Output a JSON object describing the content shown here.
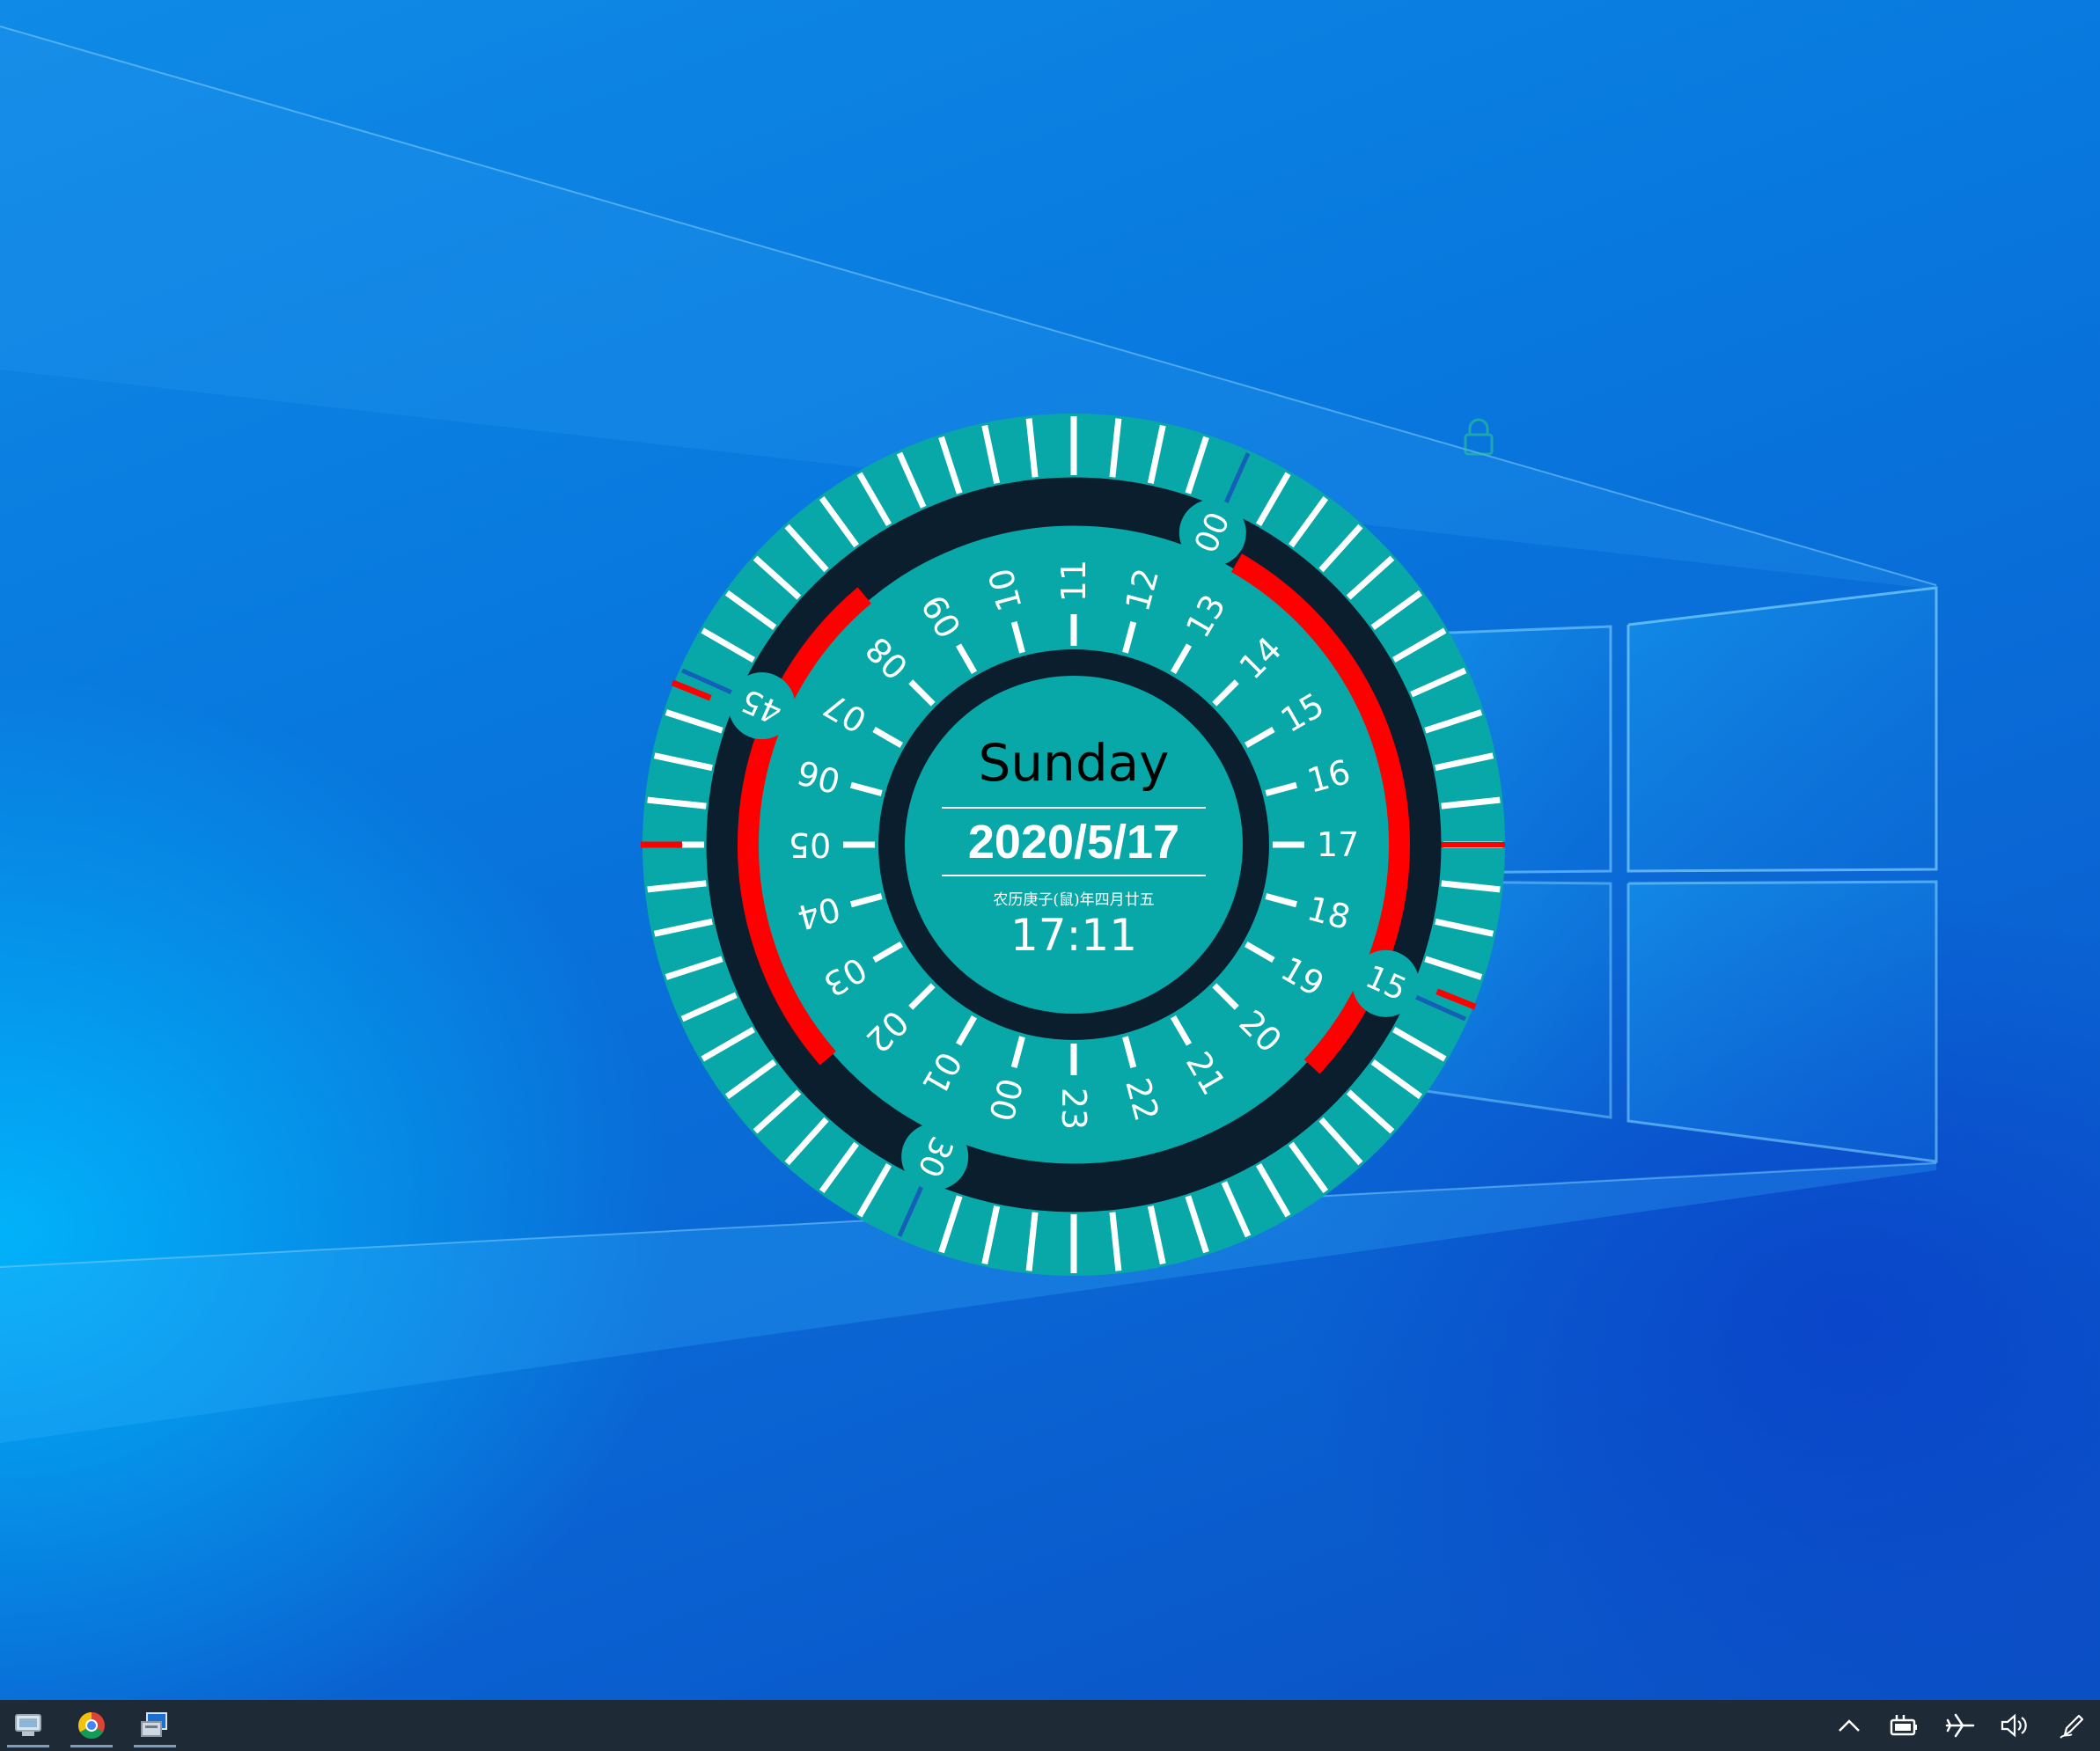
{
  "clock": {
    "weekday": "Sunday",
    "date": "2020/5/17",
    "lunar_date": "农历庚子(鼠)年四月廿五",
    "time": "17:11",
    "hour_labels": [
      "00",
      "01",
      "02",
      "03",
      "04",
      "05",
      "06",
      "07",
      "08",
      "09",
      "10",
      "11",
      "12",
      "13",
      "14",
      "15",
      "16",
      "17",
      "18",
      "19",
      "20",
      "21",
      "22",
      "23"
    ],
    "quarter_labels": [
      "00",
      "15",
      "30",
      "45"
    ],
    "current_hour": 17,
    "current_minute": 11,
    "colors": {
      "teal": "#08a8a8",
      "dark_ring": "#0b1e2e",
      "indicator_red": "#ff0000",
      "tick_white": "#ffffff",
      "accent_blue": "#1460b8"
    }
  },
  "taskbar": {
    "apps": [
      {
        "name": "desktop-manager",
        "icon": "computer-icon",
        "active": true
      },
      {
        "name": "chrome",
        "icon": "chrome-icon",
        "active": true
      },
      {
        "name": "settings-app",
        "icon": "app-window-icon",
        "active": true
      }
    ],
    "tray": [
      "chevron-up-icon",
      "battery-plug-icon",
      "airplane-mode-icon",
      "volume-icon",
      "pen-icon"
    ]
  }
}
